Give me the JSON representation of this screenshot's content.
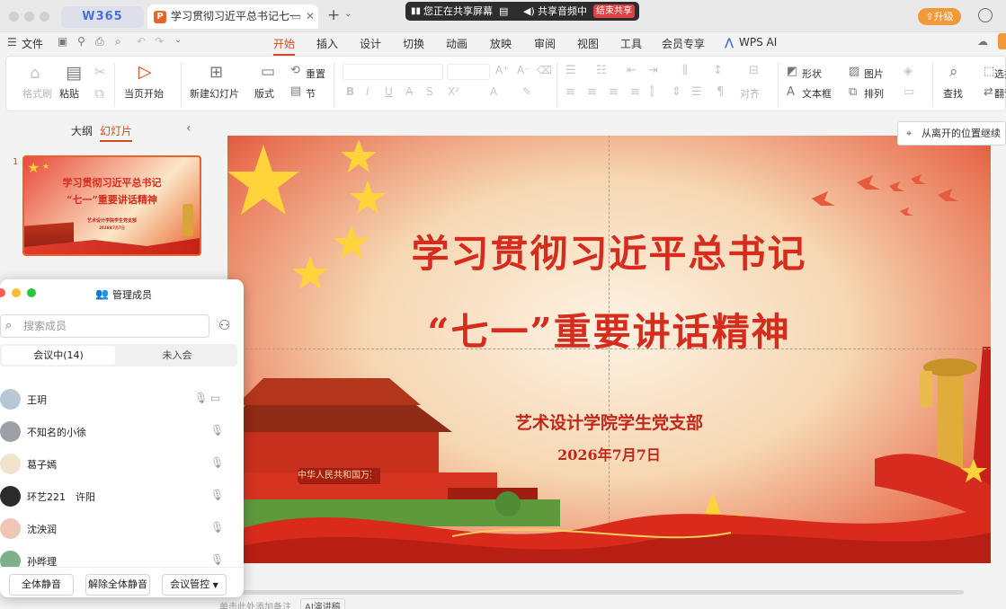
{
  "titlebar": {
    "app_logo": "W365",
    "document_tab": "学习贯彻习近平总书记七一",
    "new_tab": "+",
    "share": {
      "sharing_screen": "您正在共享屏幕",
      "sharing_audio": "共享音频中",
      "end_share": "结束共享"
    },
    "upgrade": "升级"
  },
  "menubar": {
    "file": "文件",
    "tabs": [
      "开始",
      "插入",
      "设计",
      "切换",
      "动画",
      "放映",
      "审阅",
      "视图",
      "工具",
      "会员专享",
      "WPS AI"
    ],
    "active_tab": "开始"
  },
  "ribbon": {
    "format_painter": "格式刷",
    "paste": "粘贴",
    "play_from_current": "当页开始",
    "new_slide": "新建幻灯片",
    "layout": "版式",
    "reset": "重置",
    "section": "节",
    "align": "对齐",
    "shapes": "形状",
    "picture": "图片",
    "textbox": "文本框",
    "arrange": "排列",
    "find": "查找",
    "select": "选择",
    "translate": "翻译"
  },
  "leftpane": {
    "outline_tab": "大纲",
    "slides_tab": "幻灯片",
    "slide_number": "1",
    "thumb_title1": "学习贯彻习近平总书记",
    "thumb_title2": "“七一”重要讲话精神",
    "thumb_org": "艺术设计学院学生党支部",
    "thumb_date": "2026年7月7日"
  },
  "slide": {
    "title_line1": "学习贯彻习近平总书记",
    "title_line2": "“七一”重要讲话精神",
    "organization": "艺术设计学院学生党支部",
    "date": "2026年7月7日",
    "gate_banner": "中华人民共和国万岁"
  },
  "resume_tip": "从离开的位置继续",
  "member_panel": {
    "title": "管理成员",
    "search_placeholder": "搜索成员",
    "tab_in_meeting": "会议中(14)",
    "tab_not_joined": "未入会",
    "members": [
      {
        "name": "王玥",
        "avatar_color": "#b8c7d6"
      },
      {
        "name": "不知名的小徐",
        "avatar_color": "#9aa0a6"
      },
      {
        "name": "葛子嫣",
        "avatar_color": "#f2e3cf"
      },
      {
        "name": "环艺221　许阳",
        "avatar_color": "#2b2b2b"
      },
      {
        "name": "沈泱润",
        "avatar_color": "#f0c6b6"
      },
      {
        "name": "孙晔理",
        "avatar_color": "#7fb08c"
      }
    ],
    "mute_all": "全体静音",
    "unmute_all": "解除全体静音",
    "meeting_control": "会议管控"
  },
  "statusbar": {
    "notes_hint": "单击此处添加备注",
    "ai_speech": "AI演讲稿"
  },
  "colors": {
    "accent": "#d14b1e",
    "slide_title": "#d52c1e",
    "share_end": "#e04242",
    "upgrade": "#f29a3b"
  }
}
